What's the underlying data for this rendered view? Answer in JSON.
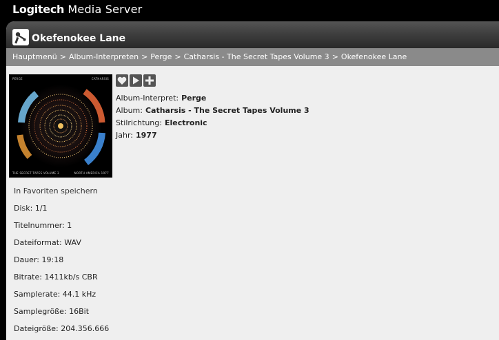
{
  "app": {
    "brand_bold": "Logitech",
    "brand_rest": "Media Server"
  },
  "title": "Okefenokee Lane",
  "breadcrumbs": [
    "Hauptmenü",
    "Album-Interpreten",
    "Perge",
    "Catharsis - The Secret Tapes Volume 3",
    "Okefenokee Lane"
  ],
  "breadcrumb_separator": ">",
  "cover": {
    "top_left": "PERGE",
    "top_right": "CATHARSIS",
    "bottom_left": "THE SECRET TAPES VOLUME 3",
    "bottom_right": "NORTH AMERICA 1977"
  },
  "actions": [
    {
      "name": "favorite-button",
      "icon": "heart-icon"
    },
    {
      "name": "play-button",
      "icon": "play-icon"
    },
    {
      "name": "add-button",
      "icon": "plus-icon"
    }
  ],
  "meta": {
    "album_artist_label": "Album-Interpret:",
    "album_artist": "Perge",
    "album_label": "Album:",
    "album": "Catharsis - The Secret Tapes Volume 3",
    "genre_label": "Stilrichtung:",
    "genre": "Electronic",
    "year_label": "Jahr:",
    "year": "1977"
  },
  "favorites_link": "In Favoriten speichern",
  "details": [
    {
      "label": "Disk:",
      "value": "1/1"
    },
    {
      "label": "Titelnummer:",
      "value": "1"
    },
    {
      "label": "Dateiformat:",
      "value": "WAV"
    },
    {
      "label": "Dauer:",
      "value": "19:18"
    },
    {
      "label": "Bitrate:",
      "value": "1411kb/s CBR"
    },
    {
      "label": "Samplerate:",
      "value": "44.1 kHz"
    },
    {
      "label": "Samplegröße:",
      "value": "16Bit"
    },
    {
      "label": "Dateigröße:",
      "value": "204.356.666"
    }
  ],
  "colors": {
    "topbar": "#000000",
    "panel": "#efefef",
    "titlebar": "#3f3f3f",
    "breadcrumb_bar": "#8a8a8a",
    "action_button": "#555555"
  }
}
